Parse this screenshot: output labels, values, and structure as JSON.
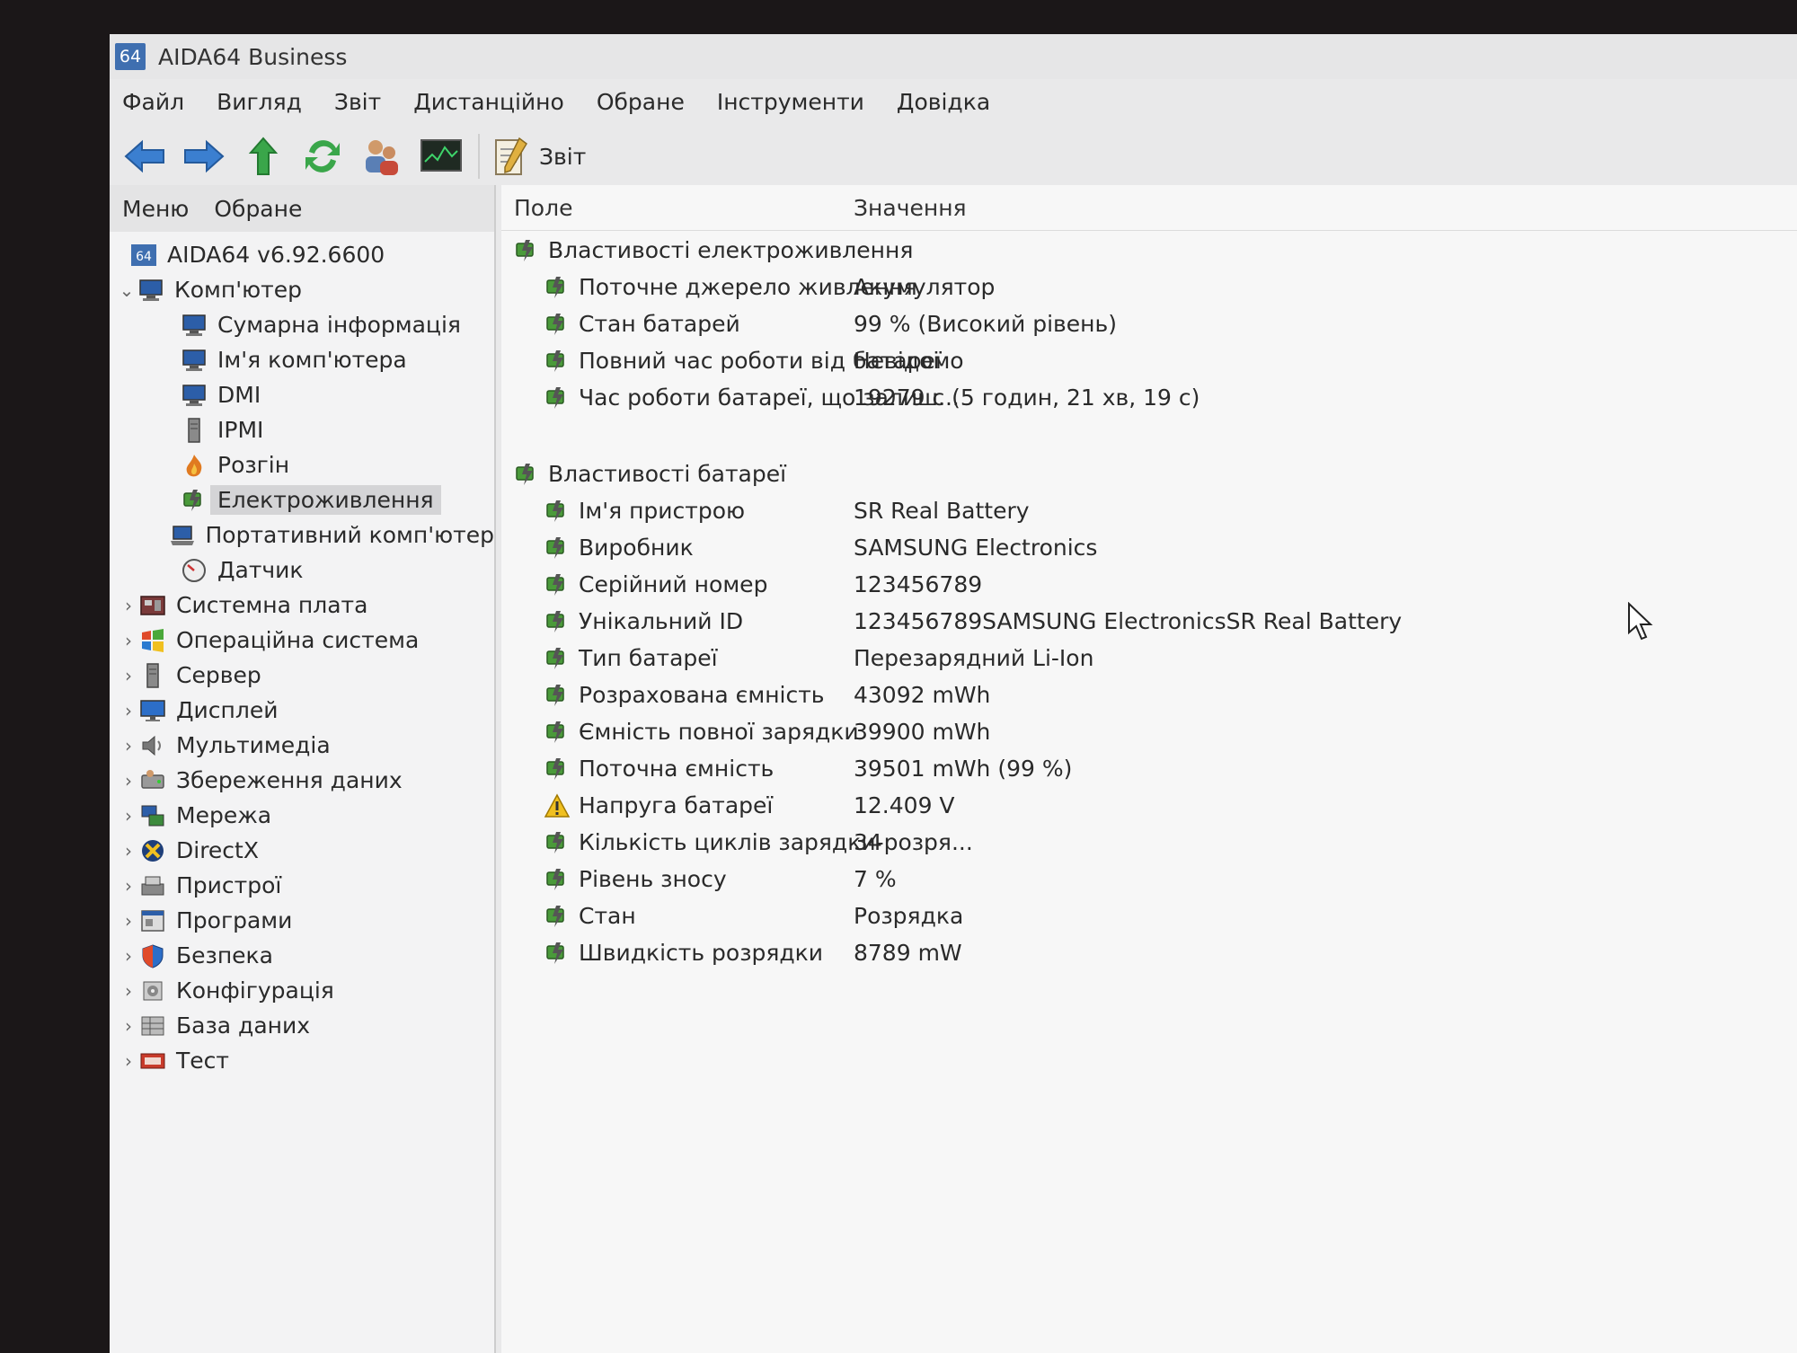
{
  "window": {
    "app_icon_text": "64",
    "title": "AIDA64 Business"
  },
  "menu": [
    "Файл",
    "Вигляд",
    "Звіт",
    "Дистанційно",
    "Обране",
    "Інструменти",
    "Довідка"
  ],
  "toolbar": {
    "buttons": [
      "back-icon",
      "forward-icon",
      "up-icon",
      "refresh-icon",
      "users-icon",
      "monitor-icon"
    ],
    "report_label": "Звіт"
  },
  "left_tabs": [
    "Меню",
    "Обране"
  ],
  "tree": {
    "root": "AIDA64 v6.92.6600",
    "computer": "Комп'ютер",
    "computer_children": [
      "Сумарна інформація",
      "Ім'я комп'ютера",
      "DMI",
      "IPMI",
      "Розгін",
      "Електроживлення",
      "Портативний комп'ютер",
      "Датчик"
    ],
    "selected": "Електроживлення",
    "categories": [
      "Системна плата",
      "Операційна система",
      "Сервер",
      "Дисплей",
      "Мультимедіа",
      "Збереження даних",
      "Мережа",
      "DirectX",
      "Пристрої",
      "Програми",
      "Безпека",
      "Конфігурація",
      "База даних",
      "Тест"
    ]
  },
  "columns": {
    "field": "Поле",
    "value": "Значення"
  },
  "sections": [
    {
      "title": "Властивості електроживлення",
      "rows": [
        {
          "field": "Поточне джерело живлення",
          "value": "Акумулятор"
        },
        {
          "field": "Стан батарей",
          "value": "99 % (Високий рівень)"
        },
        {
          "field": "Повний час роботи від батареї",
          "value": "Невідомо"
        },
        {
          "field": "Час роботи батареї, що залиш...",
          "value": "19279 с (5 годин, 21 хв, 19 с)"
        }
      ]
    },
    {
      "title": "Властивості батареї",
      "rows": [
        {
          "field": "Ім'я пристрою",
          "value": "SR Real Battery"
        },
        {
          "field": "Виробник",
          "value": "SAMSUNG Electronics"
        },
        {
          "field": "Серійний номер",
          "value": "123456789"
        },
        {
          "field": "Унікальний ID",
          "value": "123456789SAMSUNG ElectronicsSR Real Battery"
        },
        {
          "field": "Тип батареї",
          "value": "Перезарядний Li-Ion"
        },
        {
          "field": "Розрахована ємність",
          "value": "43092 mWh"
        },
        {
          "field": "Ємність повної зарядки",
          "value": "39900 mWh"
        },
        {
          "field": "Поточна ємність",
          "value": "39501 mWh  (99 %)"
        },
        {
          "field": "Напруга батареї",
          "value": "12.409 V",
          "icon": "warning-icon"
        },
        {
          "field": "Кількість циклів зарядки-розря...",
          "value": "34"
        },
        {
          "field": "Рівень зносу",
          "value": "7 %"
        },
        {
          "field": "Стан",
          "value": "Розрядка"
        },
        {
          "field": "Швидкість розрядки",
          "value": "8789 mW"
        }
      ]
    }
  ]
}
